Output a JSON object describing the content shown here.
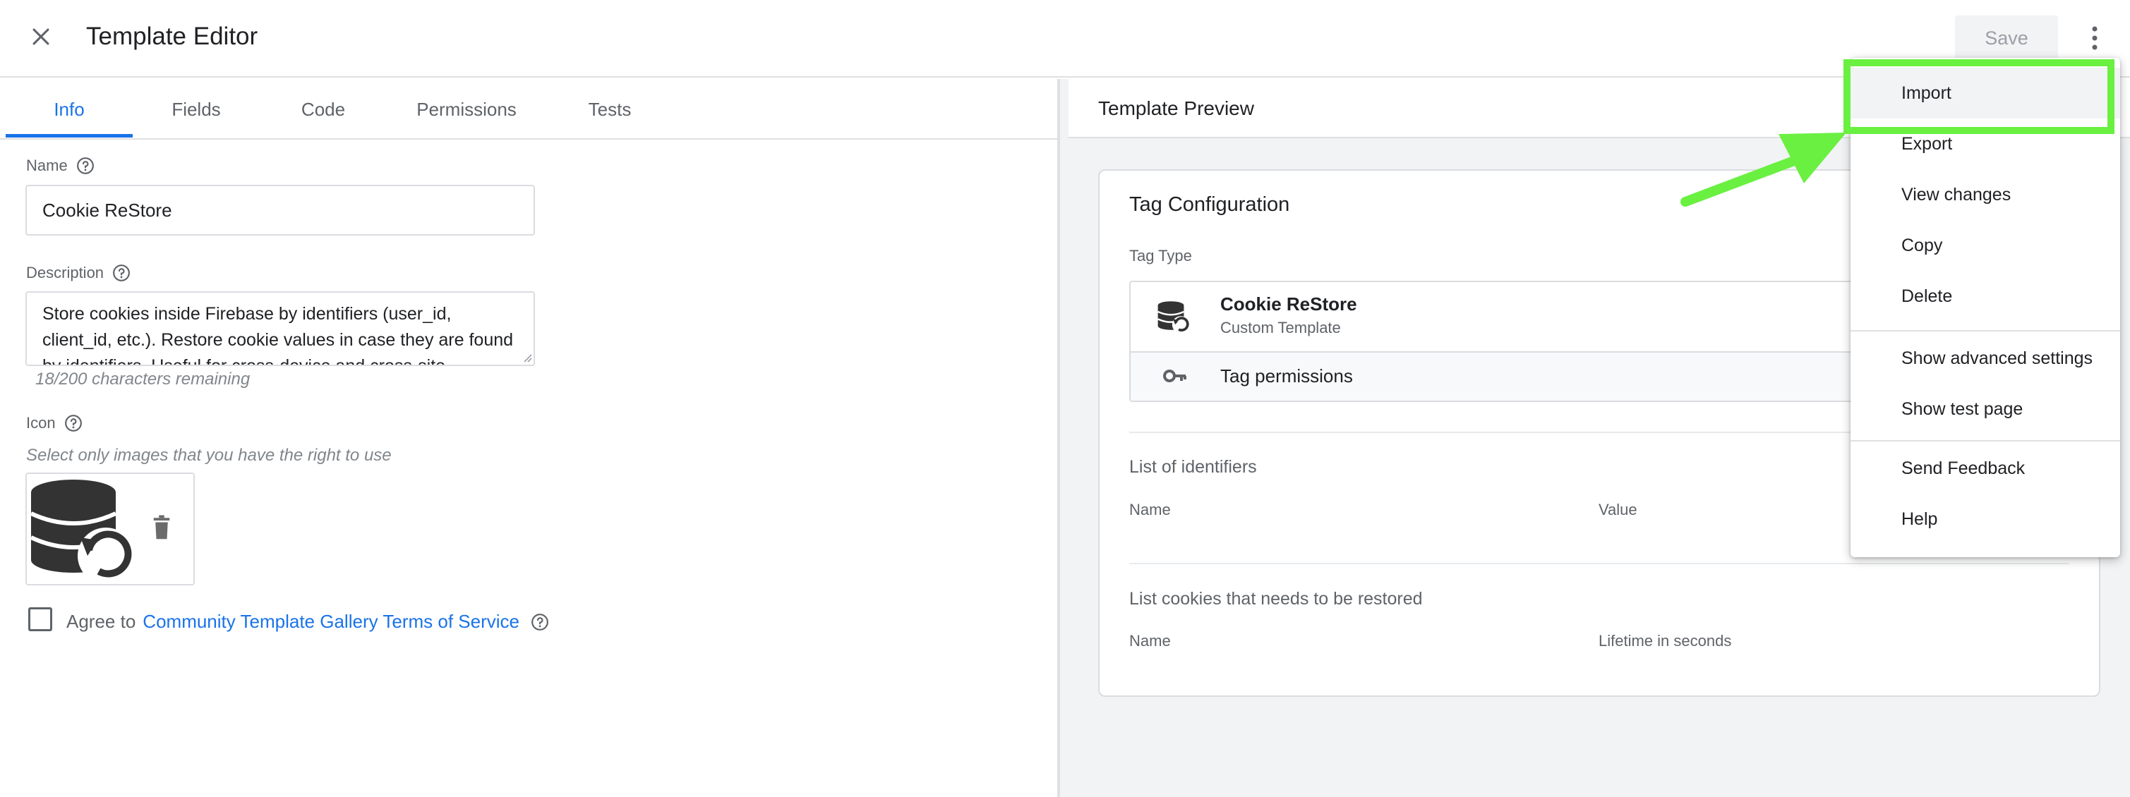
{
  "app": {
    "title": "Template Editor",
    "save_label": "Save"
  },
  "tabs": [
    {
      "label": "Info",
      "active": true
    },
    {
      "label": "Fields"
    },
    {
      "label": "Code"
    },
    {
      "label": "Permissions"
    },
    {
      "label": "Tests"
    }
  ],
  "info": {
    "name_label": "Name",
    "name_value": "Cookie ReStore",
    "description_label": "Description",
    "description_value": "Store cookies inside Firebase by identifiers (user_id, client_id, etc.). Restore cookie values in case they are found by identifiers. Useful for cross-device and cross-site",
    "chars_remaining": "18/200 characters remaining",
    "icon_label": "Icon",
    "icon_hint": "Select only images that you have the right to use",
    "agree_prefix": "Agree to",
    "agree_link": "Community Template Gallery Terms of Service"
  },
  "preview": {
    "title": "Template Preview",
    "card_title": "Tag Configuration",
    "tag_type_label": "Tag Type",
    "tag_name": "Cookie ReStore",
    "tag_subtitle": "Custom Template",
    "tag_permissions": "Tag permissions",
    "identifiers_heading": "List of identifiers",
    "identifiers_col1": "Name",
    "identifiers_col2": "Value",
    "cookies_heading": "List cookies that needs to be restored",
    "cookies_col1": "Name",
    "cookies_col2": "Lifetime in seconds"
  },
  "menu": {
    "items": [
      "Import",
      "Export",
      "View changes",
      "Copy",
      "Delete",
      "Show advanced settings",
      "Show test page",
      "Send Feedback",
      "Help"
    ]
  },
  "colors": {
    "accent": "#1a73e8",
    "highlight": "#6af041"
  }
}
